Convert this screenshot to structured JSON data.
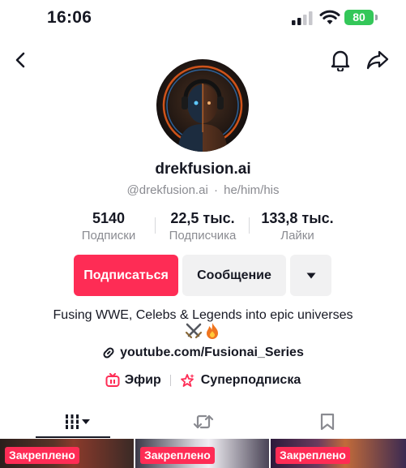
{
  "status_bar": {
    "time": "16:06",
    "battery": "80",
    "icons": [
      "signal-icon",
      "wifi-icon",
      "battery-icon"
    ]
  },
  "nav": {
    "icons": [
      "back-icon",
      "bell-icon",
      "share-icon"
    ]
  },
  "profile": {
    "username": "drekfusion.ai",
    "handle": "@drekfusion.ai",
    "pronouns": "he/him/his",
    "separator": "·"
  },
  "stats": [
    {
      "value": "5140",
      "label": "Подписки"
    },
    {
      "value": "22,5 тыс.",
      "label": "Подписчика"
    },
    {
      "value": "133,8 тыс.",
      "label": "Лайки"
    }
  ],
  "actions": {
    "follow_label": "Подписаться",
    "message_label": "Сообщение",
    "more_icon": "caret-down-icon"
  },
  "bio": {
    "text": "Fusing WWE, Celebs & Legends into epic universes",
    "emoji": [
      "crossed-swords-icon",
      "fire-icon"
    ]
  },
  "link": {
    "text": "youtube.com/Fusionai_Series",
    "icon": "link-icon"
  },
  "features": [
    {
      "label": "Эфир",
      "icon": "live-tv-icon"
    },
    {
      "label": "Суперподписка",
      "icon": "super-follow-icon"
    }
  ],
  "tabs": [
    {
      "name": "videos",
      "icon": "grid-icon"
    },
    {
      "name": "reposts",
      "icon": "repost-icon"
    },
    {
      "name": "saved",
      "icon": "bookmark-icon"
    }
  ],
  "thumbnails": [
    {
      "badge": "Закреплено"
    },
    {
      "badge": "Закреплено"
    },
    {
      "badge": "Закреплено"
    }
  ],
  "colors": {
    "accent": "#fe2c55",
    "text": "#161823",
    "muted": "#8a8b91",
    "button_secondary": "#f1f1f2",
    "battery": "#34c759"
  }
}
